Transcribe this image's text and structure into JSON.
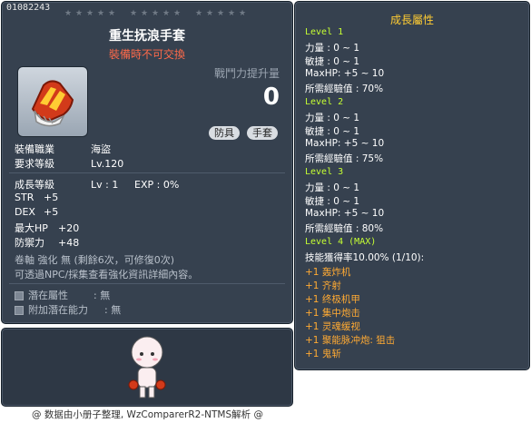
{
  "item": {
    "id": "01082243",
    "name": "重生抚浪手套",
    "tradeability": "裝備時不可交換",
    "power_label": "戰鬥力提升量",
    "power_value": "0",
    "tags": [
      "防具",
      "手套"
    ],
    "job_label": "裝備職業",
    "job_value": "海盜",
    "level_req_label": "要求等級",
    "level_req_value": "Lv.120",
    "growth": {
      "label": "成長等級",
      "lv": "Lv : 1",
      "exp": "EXP : 0%"
    },
    "stats": [
      {
        "k": "STR",
        "v": "+5"
      },
      {
        "k": "DEX",
        "v": "+5"
      },
      {
        "k": "最大HP",
        "v": "+20"
      },
      {
        "k": "防禦力",
        "v": "+48"
      }
    ],
    "scroll_text": "卷軸 強化 無 (剩餘6次，可修復0次)",
    "npc_note": "可透過NPC/採集查看強化資訊詳細內容。",
    "potential": [
      {
        "label": "潛在屬性",
        "value": ": 無"
      },
      {
        "label": "附加潛在能力",
        "value": ": 無"
      }
    ]
  },
  "growth_panel": {
    "title": "成長屬性",
    "levels": [
      {
        "name": "Level 1",
        "lines": [
          "力量 : 0 ~ 1",
          "敏捷 : 0 ~ 1",
          "MaxHP:  +5 ~ 10",
          "所需經驗值 : 70%"
        ]
      },
      {
        "name": "Level 2",
        "lines": [
          "力量 : 0 ~ 1",
          "敏捷 : 0 ~ 1",
          "MaxHP:  +5 ~ 10",
          "所需經驗值 : 75%"
        ]
      },
      {
        "name": "Level 3",
        "lines": [
          "力量 : 0 ~ 1",
          "敏捷 : 0 ~ 1",
          "MaxHP:  +5 ~ 10",
          "所需經驗值 : 80%"
        ]
      },
      {
        "name": "Level 4 (MAX)",
        "lines": [
          "技能獲得率10.00% (1/10):"
        ]
      }
    ],
    "skills": [
      "+1 轰炸机",
      "+1 齐射",
      "+1 终极机甲",
      "+1 集中炮击",
      "+1 灵魂缓视",
      "+1 聚能脉冲炮: 狙击",
      "+1 鬼斩"
    ]
  },
  "footer": "@ 数据由小册子整理, WzComparerR2-NTMS解析 @",
  "colors": {
    "panel": "#36414f",
    "level": "#c6ff33",
    "skill": "#ffaa33",
    "title": "#ffcc33",
    "warn": "#ff6a4a"
  }
}
